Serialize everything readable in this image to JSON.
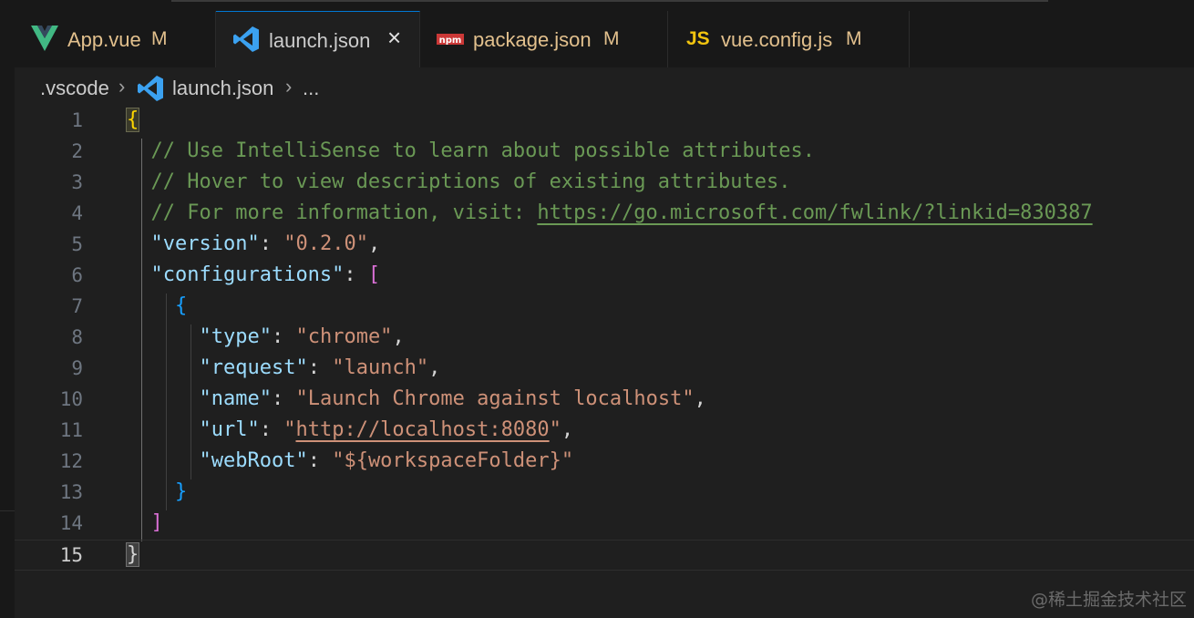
{
  "tabs": [
    {
      "label": "App.vue",
      "status": "M",
      "icon": "vue-icon",
      "active": false
    },
    {
      "label": "launch.json",
      "status": "",
      "icon": "vscode-json-icon",
      "active": true,
      "close": "×"
    },
    {
      "label": "package.json",
      "status": "M",
      "icon": "npm-icon",
      "icon_text": "npm",
      "active": false
    },
    {
      "label": "vue.config.js",
      "status": "M",
      "icon": "js-icon",
      "icon_text": "JS",
      "active": false
    }
  ],
  "breadcrumb": {
    "folder": ".vscode",
    "file": "launch.json",
    "symbol": "...",
    "separator": "›"
  },
  "editor": {
    "line_numbers": [
      "1",
      "2",
      "3",
      "4",
      "5",
      "6",
      "7",
      "8",
      "9",
      "10",
      "11",
      "12",
      "13",
      "14",
      "15"
    ],
    "current_line": "15",
    "comment1": "// Use IntelliSense to learn about possible attributes.",
    "comment2": "// Hover to view descriptions of existing attributes.",
    "comment3_prefix": "// For more information, visit: ",
    "comment3_link": "https://go.microsoft.com/fwlink/?linkid=830387",
    "open_brace": "{",
    "close_brace": "}",
    "open_bracket": "[",
    "close_bracket": "]",
    "colon": ": ",
    "comma": ",",
    "version_key": "\"version\"",
    "version_value": "\"0.2.0\"",
    "configurations_key": "\"configurations\"",
    "type_key": "\"type\"",
    "type_value": "\"chrome\"",
    "request_key": "\"request\"",
    "request_value": "\"launch\"",
    "name_key": "\"name\"",
    "name_value": "\"Launch Chrome against localhost\"",
    "url_key": "\"url\"",
    "url_quote": "\"",
    "url_value": "http://localhost:8080",
    "webroot_key": "\"webRoot\"",
    "webroot_value": "\"${workspaceFolder}\""
  },
  "watermark": "@稀土掘金技术社区",
  "colors": {
    "comment": "#6a9955",
    "key": "#9cdcfe",
    "string": "#ce9178",
    "bracket_level1": "#ffd700",
    "bracket_level2": "#da70d6",
    "bracket_level3": "#179fff",
    "modified": "#e2c08d",
    "accent": "#0078d4"
  }
}
